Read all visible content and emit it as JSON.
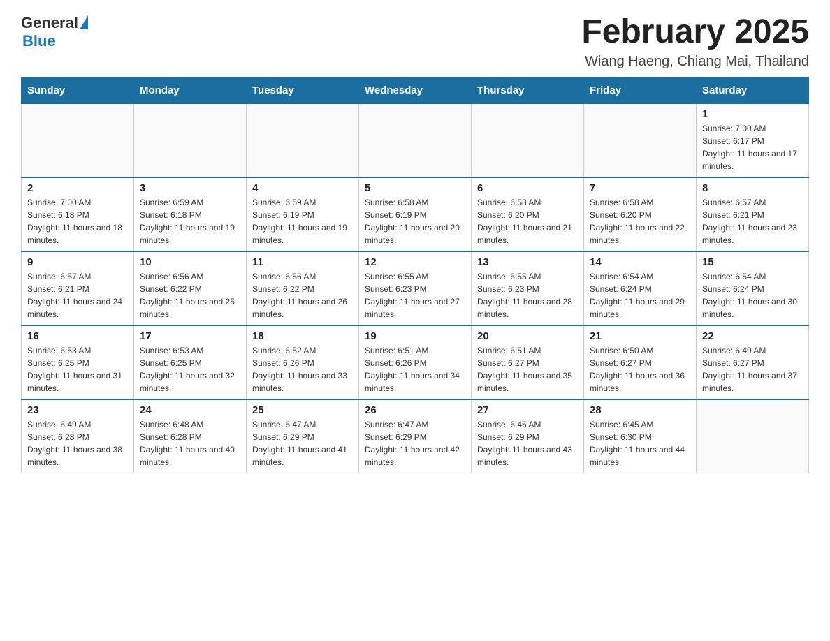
{
  "header": {
    "logo_general": "General",
    "logo_blue": "Blue",
    "title": "February 2025",
    "location": "Wiang Haeng, Chiang Mai, Thailand"
  },
  "days_of_week": [
    "Sunday",
    "Monday",
    "Tuesday",
    "Wednesday",
    "Thursday",
    "Friday",
    "Saturday"
  ],
  "weeks": [
    [
      {
        "day": "",
        "sunrise": "",
        "sunset": "",
        "daylight": ""
      },
      {
        "day": "",
        "sunrise": "",
        "sunset": "",
        "daylight": ""
      },
      {
        "day": "",
        "sunrise": "",
        "sunset": "",
        "daylight": ""
      },
      {
        "day": "",
        "sunrise": "",
        "sunset": "",
        "daylight": ""
      },
      {
        "day": "",
        "sunrise": "",
        "sunset": "",
        "daylight": ""
      },
      {
        "day": "",
        "sunrise": "",
        "sunset": "",
        "daylight": ""
      },
      {
        "day": "1",
        "sunrise": "Sunrise: 7:00 AM",
        "sunset": "Sunset: 6:17 PM",
        "daylight": "Daylight: 11 hours and 17 minutes."
      }
    ],
    [
      {
        "day": "2",
        "sunrise": "Sunrise: 7:00 AM",
        "sunset": "Sunset: 6:18 PM",
        "daylight": "Daylight: 11 hours and 18 minutes."
      },
      {
        "day": "3",
        "sunrise": "Sunrise: 6:59 AM",
        "sunset": "Sunset: 6:18 PM",
        "daylight": "Daylight: 11 hours and 19 minutes."
      },
      {
        "day": "4",
        "sunrise": "Sunrise: 6:59 AM",
        "sunset": "Sunset: 6:19 PM",
        "daylight": "Daylight: 11 hours and 19 minutes."
      },
      {
        "day": "5",
        "sunrise": "Sunrise: 6:58 AM",
        "sunset": "Sunset: 6:19 PM",
        "daylight": "Daylight: 11 hours and 20 minutes."
      },
      {
        "day": "6",
        "sunrise": "Sunrise: 6:58 AM",
        "sunset": "Sunset: 6:20 PM",
        "daylight": "Daylight: 11 hours and 21 minutes."
      },
      {
        "day": "7",
        "sunrise": "Sunrise: 6:58 AM",
        "sunset": "Sunset: 6:20 PM",
        "daylight": "Daylight: 11 hours and 22 minutes."
      },
      {
        "day": "8",
        "sunrise": "Sunrise: 6:57 AM",
        "sunset": "Sunset: 6:21 PM",
        "daylight": "Daylight: 11 hours and 23 minutes."
      }
    ],
    [
      {
        "day": "9",
        "sunrise": "Sunrise: 6:57 AM",
        "sunset": "Sunset: 6:21 PM",
        "daylight": "Daylight: 11 hours and 24 minutes."
      },
      {
        "day": "10",
        "sunrise": "Sunrise: 6:56 AM",
        "sunset": "Sunset: 6:22 PM",
        "daylight": "Daylight: 11 hours and 25 minutes."
      },
      {
        "day": "11",
        "sunrise": "Sunrise: 6:56 AM",
        "sunset": "Sunset: 6:22 PM",
        "daylight": "Daylight: 11 hours and 26 minutes."
      },
      {
        "day": "12",
        "sunrise": "Sunrise: 6:55 AM",
        "sunset": "Sunset: 6:23 PM",
        "daylight": "Daylight: 11 hours and 27 minutes."
      },
      {
        "day": "13",
        "sunrise": "Sunrise: 6:55 AM",
        "sunset": "Sunset: 6:23 PM",
        "daylight": "Daylight: 11 hours and 28 minutes."
      },
      {
        "day": "14",
        "sunrise": "Sunrise: 6:54 AM",
        "sunset": "Sunset: 6:24 PM",
        "daylight": "Daylight: 11 hours and 29 minutes."
      },
      {
        "day": "15",
        "sunrise": "Sunrise: 6:54 AM",
        "sunset": "Sunset: 6:24 PM",
        "daylight": "Daylight: 11 hours and 30 minutes."
      }
    ],
    [
      {
        "day": "16",
        "sunrise": "Sunrise: 6:53 AM",
        "sunset": "Sunset: 6:25 PM",
        "daylight": "Daylight: 11 hours and 31 minutes."
      },
      {
        "day": "17",
        "sunrise": "Sunrise: 6:53 AM",
        "sunset": "Sunset: 6:25 PM",
        "daylight": "Daylight: 11 hours and 32 minutes."
      },
      {
        "day": "18",
        "sunrise": "Sunrise: 6:52 AM",
        "sunset": "Sunset: 6:26 PM",
        "daylight": "Daylight: 11 hours and 33 minutes."
      },
      {
        "day": "19",
        "sunrise": "Sunrise: 6:51 AM",
        "sunset": "Sunset: 6:26 PM",
        "daylight": "Daylight: 11 hours and 34 minutes."
      },
      {
        "day": "20",
        "sunrise": "Sunrise: 6:51 AM",
        "sunset": "Sunset: 6:27 PM",
        "daylight": "Daylight: 11 hours and 35 minutes."
      },
      {
        "day": "21",
        "sunrise": "Sunrise: 6:50 AM",
        "sunset": "Sunset: 6:27 PM",
        "daylight": "Daylight: 11 hours and 36 minutes."
      },
      {
        "day": "22",
        "sunrise": "Sunrise: 6:49 AM",
        "sunset": "Sunset: 6:27 PM",
        "daylight": "Daylight: 11 hours and 37 minutes."
      }
    ],
    [
      {
        "day": "23",
        "sunrise": "Sunrise: 6:49 AM",
        "sunset": "Sunset: 6:28 PM",
        "daylight": "Daylight: 11 hours and 38 minutes."
      },
      {
        "day": "24",
        "sunrise": "Sunrise: 6:48 AM",
        "sunset": "Sunset: 6:28 PM",
        "daylight": "Daylight: 11 hours and 40 minutes."
      },
      {
        "day": "25",
        "sunrise": "Sunrise: 6:47 AM",
        "sunset": "Sunset: 6:29 PM",
        "daylight": "Daylight: 11 hours and 41 minutes."
      },
      {
        "day": "26",
        "sunrise": "Sunrise: 6:47 AM",
        "sunset": "Sunset: 6:29 PM",
        "daylight": "Daylight: 11 hours and 42 minutes."
      },
      {
        "day": "27",
        "sunrise": "Sunrise: 6:46 AM",
        "sunset": "Sunset: 6:29 PM",
        "daylight": "Daylight: 11 hours and 43 minutes."
      },
      {
        "day": "28",
        "sunrise": "Sunrise: 6:45 AM",
        "sunset": "Sunset: 6:30 PM",
        "daylight": "Daylight: 11 hours and 44 minutes."
      },
      {
        "day": "",
        "sunrise": "",
        "sunset": "",
        "daylight": ""
      }
    ]
  ]
}
